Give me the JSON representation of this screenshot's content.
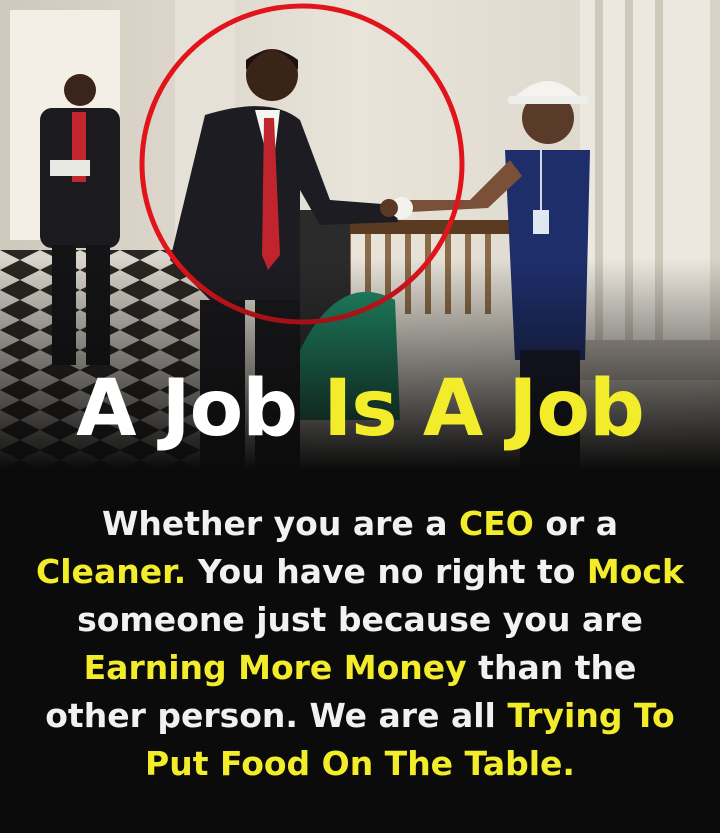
{
  "headline": {
    "part1": "A Job ",
    "part2": "Is A Job"
  },
  "message": {
    "l1a": "Whether you are a ",
    "l1b": "CEO",
    "l1c": " or a",
    "l2a": "Cleaner.",
    "l2b": " You have no right to ",
    "l2c": "Mock",
    "l3a": "someone just because you are",
    "l4a": "Earning More Money",
    "l4b": " than the",
    "l5a": "other person. We are all ",
    "l5b": "Trying To",
    "l6a": "Put Food On The Table."
  },
  "colors": {
    "background": "#0b0b0b",
    "highlight": "#f2ec2b",
    "text": "#f1f1f1",
    "circle": "#e2141b"
  }
}
